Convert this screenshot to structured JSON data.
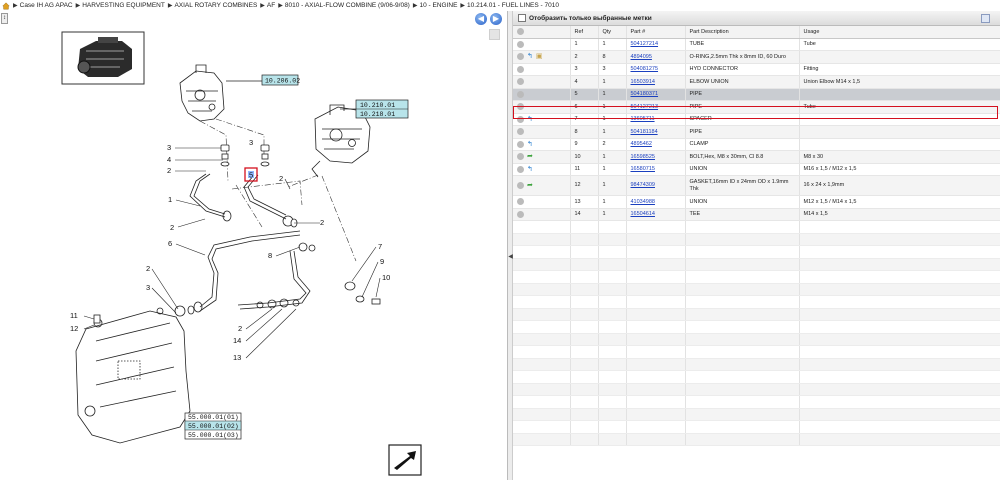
{
  "breadcrumb": {
    "items": [
      "Case IH AG APAC",
      "HARVESTING EQUIPMENT",
      "AXIAL ROTARY COMBINES",
      "AF",
      "8010 - AXIAL-FLOW COMBINE (9/06-9/08)",
      "10 - ENGINE",
      "10.214.01 - FUEL LINES - 7010"
    ]
  },
  "diagram": {
    "ref_top": "10.206.02",
    "ref_right": [
      "10.210.01",
      "10.218.01"
    ],
    "ref_bottom": [
      "55.000.01(01)",
      "55.000.01(02)",
      "55.000.01(03)"
    ],
    "highlighted_ref": "5",
    "callouts": {
      "c1": "1",
      "c2a": "2",
      "c2b": "2",
      "c2c": "2",
      "c2d": "2",
      "c2e": "2",
      "c2f": "2",
      "c3a": "3",
      "c3b": "3",
      "c3c": "3",
      "c4": "4",
      "c6": "6",
      "c7": "7",
      "c8": "8",
      "c9": "9",
      "c10": "10",
      "c11": "11",
      "c12": "12",
      "c13": "13",
      "c14": "14"
    },
    "nav_prev": "◀",
    "nav_next": "▶"
  },
  "parts": {
    "header_label": "Отобразить только выбранные метки",
    "columns": [
      "",
      "Ref",
      "Qty",
      "Part #",
      "Part Description",
      "Usage"
    ],
    "rows": [
      {
        "ref": "1",
        "qty": "1",
        "part": "504127214",
        "desc": "TUBE",
        "usage": "Tube",
        "icons": []
      },
      {
        "ref": "2",
        "qty": "8",
        "part": "4894095",
        "desc": "O-RING,2.5mm Thk x 8mm ID, 60 Duro",
        "usage": "",
        "icons": [
          "blue",
          "box"
        ]
      },
      {
        "ref": "3",
        "qty": "3",
        "part": "504081275",
        "desc": "HYD CONNECTOR",
        "usage": "Fitting",
        "icons": []
      },
      {
        "ref": "4",
        "qty": "1",
        "part": "16503914",
        "desc": "ELBOW UNION",
        "usage": "Union Elbow M14 x 1,5",
        "icons": []
      },
      {
        "ref": "5",
        "qty": "1",
        "part": "504180371",
        "desc": "PIPE",
        "usage": "",
        "icons": []
      },
      {
        "ref": "6",
        "qty": "1",
        "part": "504127213",
        "desc": "PIPE",
        "usage": "Tube",
        "icons": []
      },
      {
        "ref": "7",
        "qty": "1",
        "part": "13605711",
        "desc": "SPACER",
        "usage": "",
        "icons": [
          "blue"
        ]
      },
      {
        "ref": "8",
        "qty": "1",
        "part": "504181184",
        "desc": "PIPE",
        "usage": "",
        "icons": []
      },
      {
        "ref": "9",
        "qty": "2",
        "part": "4895462",
        "desc": "CLAMP",
        "usage": "",
        "icons": [
          "blue"
        ]
      },
      {
        "ref": "10",
        "qty": "1",
        "part": "16598525",
        "desc": "BOLT,Hex, M8 x 30mm, Cl 8.8",
        "usage": "M8 x 30",
        "icons": [
          "green"
        ]
      },
      {
        "ref": "11",
        "qty": "1",
        "part": "16580715",
        "desc": "UNION",
        "usage": "M16 x 1,5 / M12 x 1,5",
        "icons": [
          "blue"
        ]
      },
      {
        "ref": "12",
        "qty": "1",
        "part": "98474309",
        "desc": "GASKET,16mm ID x 24mm OD x 1.9mm Thk",
        "usage": "16 x 24 x 1,9mm",
        "icons": [
          "green"
        ]
      },
      {
        "ref": "13",
        "qty": "1",
        "part": "41034988",
        "desc": "UNION",
        "usage": "M12 x 1,5 / M14 x 1,5",
        "icons": []
      },
      {
        "ref": "14",
        "qty": "1",
        "part": "16504614",
        "desc": "TEE",
        "usage": "M14 x 1,5",
        "icons": []
      }
    ],
    "selected_ref": "5"
  }
}
